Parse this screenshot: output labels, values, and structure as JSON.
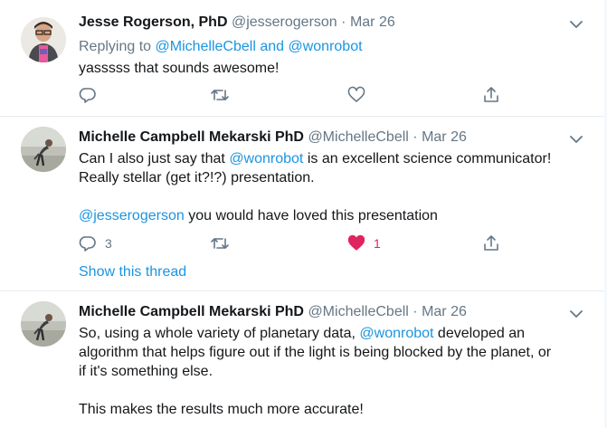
{
  "tweets": [
    {
      "author_name": "Jesse Rogerson, PhD",
      "handle": "@jesserogerson",
      "separator": "·",
      "date": "Mar 26",
      "reply_prefix": "Replying to ",
      "reply_user1": "@MichelleCbell",
      "reply_and": " and ",
      "reply_user2": "@wonrobot",
      "text": "yasssss that sounds awesome!",
      "reply_count": "",
      "like_count": ""
    },
    {
      "author_name": "Michelle Campbell Mekarski PhD",
      "handle": "@MichelleCbell",
      "separator": "·",
      "date": "Mar 26",
      "line1_pre": "Can I also just say that ",
      "line1_link": "@wonrobot",
      "line1_post": " is an excellent science communicator!",
      "line2": "Really stellar (get it?!?) presentation.",
      "line3_link": "@jesserogerson",
      "line3_post": " you would have loved this presentation",
      "reply_count": "3",
      "like_count": "1",
      "liked": true,
      "show_thread": "Show this thread"
    },
    {
      "author_name": "Michelle Campbell Mekarski PhD",
      "handle": "@MichelleCbell",
      "separator": "·",
      "date": "Mar 26",
      "line1_pre": "So, using a whole variety of planetary data, ",
      "line1_link": "@wonrobot",
      "line1_post": " developed an",
      "line2": "algorithm that helps figure out if the light is being blocked by the planet, or",
      "line3": "if it's something else.",
      "line4": "This makes the results much more accurate!"
    }
  ],
  "colors": {
    "link": "#1b95e0",
    "muted": "#657786",
    "like_active": "#e0245e",
    "divider": "#e6ecf0"
  },
  "icons": [
    "chevron-down-icon",
    "reply-icon",
    "retweet-icon",
    "like-icon",
    "share-icon"
  ]
}
